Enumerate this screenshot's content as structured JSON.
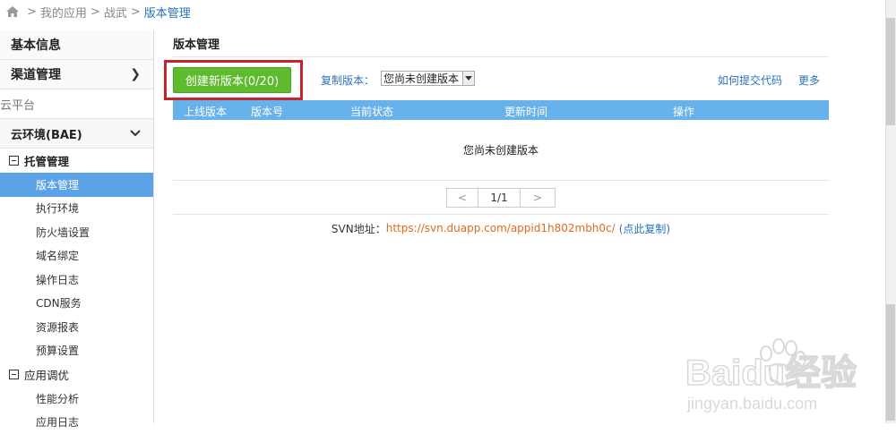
{
  "breadcrumb": {
    "items": [
      "我的应用",
      "战武"
    ],
    "sep": ">",
    "current": "版本管理"
  },
  "sidebar": {
    "basic_info": "基本信息",
    "channel": "渠道管理",
    "cloud_platform": "云平台",
    "cloud_env": "云环境(BAE)",
    "hosting": "托管管理",
    "hosting_items": [
      "版本管理",
      "执行环境",
      "防火墙设置",
      "域名绑定",
      "操作日志",
      "CDN服务",
      "资源报表",
      "预算设置"
    ],
    "app_tuning": "应用调优",
    "tuning_items": [
      "性能分析",
      "应用日志"
    ]
  },
  "main": {
    "title": "版本管理",
    "create_button": "创建新版本(0/20)",
    "copy_label": "复制版本：",
    "copy_select": "您尚未创建版本",
    "link_howto": "如何提交代码",
    "link_more": "更多",
    "columns": [
      "上线版本",
      "版本号",
      "当前状态",
      "更新时间",
      "操作"
    ],
    "empty_text": "您尚未创建版本",
    "pager": {
      "prev": "<",
      "page": "1/1",
      "next": ">"
    },
    "svn_label": "SVN地址：",
    "svn_url": "https://svn.duapp.com/appid1h802mbh0c/",
    "svn_copy": "(点此复制)"
  },
  "watermark": {
    "text": "Baidu经验",
    "sub": "jingyan.baidu.com"
  },
  "colors": {
    "accent": "#5ba3e6",
    "table_header": "#67b2ea",
    "create_button": "#5dbb2d",
    "highlight": "#c8232c",
    "link": "#2a73b8",
    "svn_url": "#e06b1a"
  }
}
